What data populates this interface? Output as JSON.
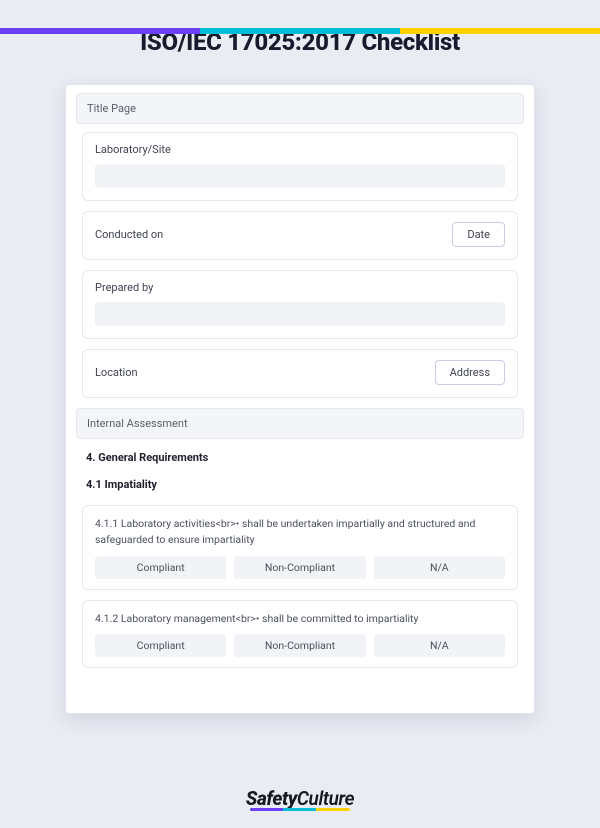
{
  "title": "ISO/IEC 17025:2017 Checklist",
  "sections": {
    "title_page": {
      "header": "Title Page",
      "fields": {
        "laboratory": {
          "label": "Laboratory/Site"
        },
        "conducted_on": {
          "label": "Conducted on",
          "button": "Date"
        },
        "prepared_by": {
          "label": "Prepared by"
        },
        "location": {
          "label": "Location",
          "button": "Address"
        }
      }
    },
    "internal_assessment": {
      "header": "Internal Assessment",
      "heading_4": "4. General Requirements",
      "heading_4_1": "4.1 Impatiality",
      "questions": [
        {
          "text": "4.1.1 Laboratory activities<br>• shall be undertaken impartially and structured and safeguarded to ensure impartiality",
          "options": [
            "Compliant",
            "Non-Compliant",
            "N/A"
          ]
        },
        {
          "text": "4.1.2 Laboratory management<br>• shall be committed to impartiality",
          "options": [
            "Compliant",
            "Non-Compliant",
            "N/A"
          ]
        }
      ]
    }
  },
  "logo": {
    "part1": "Safety",
    "part2": "Culture"
  }
}
